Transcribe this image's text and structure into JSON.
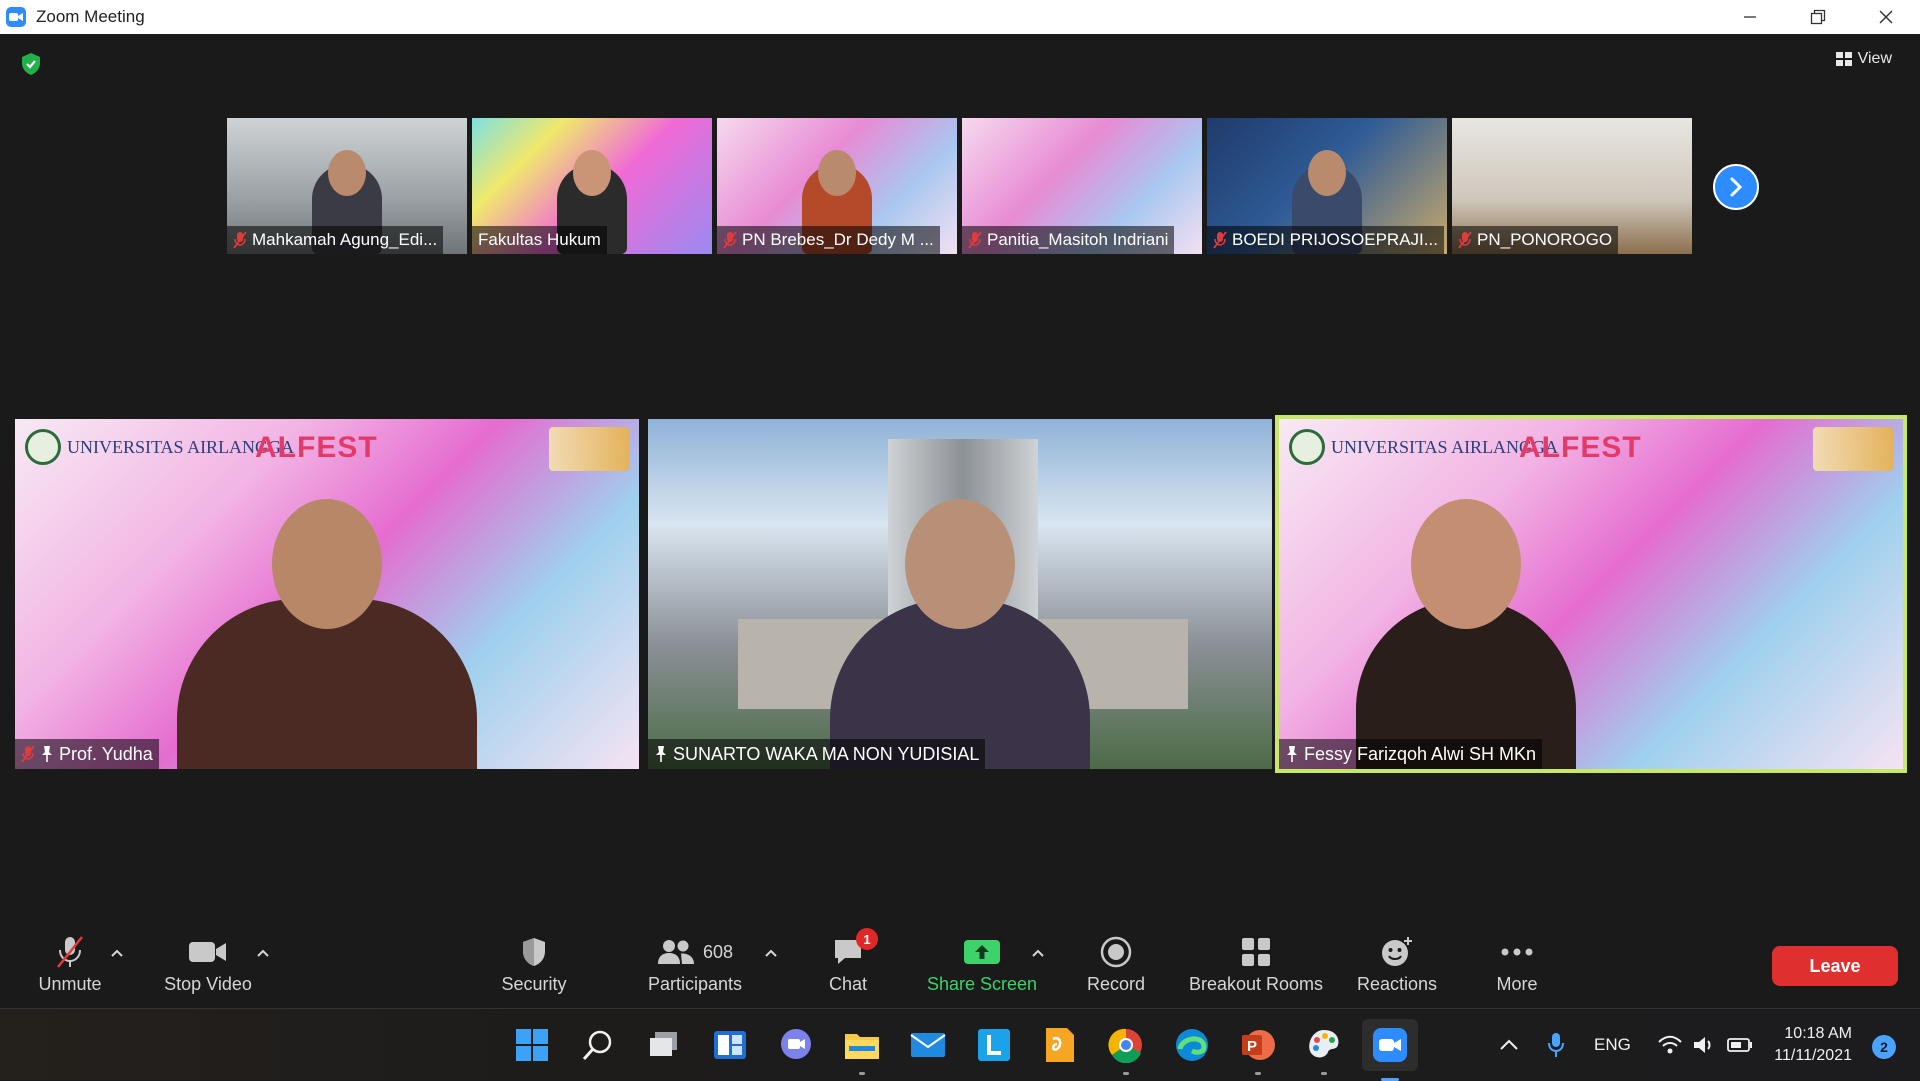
{
  "window": {
    "title": "Zoom Meeting"
  },
  "header": {
    "view_label": "View"
  },
  "strip": {
    "participants": [
      {
        "name": "Mahkamah Agung_Edi...",
        "muted": true
      },
      {
        "name": "Fakultas Hukum",
        "muted": false
      },
      {
        "name": "PN Brebes_Dr Dedy M ...",
        "muted": true
      },
      {
        "name": "Panitia_Masitoh Indriani",
        "muted": true
      },
      {
        "name": "BOEDI PRIJOSOEPRAJI...",
        "muted": true
      },
      {
        "name": "PN_PONOROGO",
        "muted": true
      }
    ]
  },
  "gallery": {
    "tiles": [
      {
        "name": "Prof. Yudha",
        "muted": true,
        "pinned": true,
        "logo_left": "UNIVERSITAS AIRLANGGA",
        "logo_mid": "ALFEST"
      },
      {
        "name": "SUNARTO WAKA MA NON YUDISIAL",
        "muted": false,
        "pinned": true
      },
      {
        "name": "Fessy Farizqoh Alwi SH MKn",
        "muted": false,
        "pinned": true,
        "speaking": true,
        "logo_left": "UNIVERSITAS AIRLANGGA",
        "logo_mid": "ALFEST"
      }
    ]
  },
  "toolbar": {
    "unmute": "Unmute",
    "stop_video": "Stop Video",
    "security": "Security",
    "participants": "Participants",
    "participants_count": "608",
    "chat": "Chat",
    "chat_badge": "1",
    "share_screen": "Share Screen",
    "record": "Record",
    "breakout_rooms": "Breakout Rooms",
    "reactions": "Reactions",
    "more": "More",
    "leave": "Leave"
  },
  "taskbar": {
    "language": "ENG",
    "time": "10:18 AM",
    "date": "11/11/2021",
    "notifications": "2"
  },
  "colors": {
    "accent_blue": "#2d8cff",
    "leave_red": "#e02f2f",
    "share_green": "#3dd26a",
    "speaker_highlight": "#c8e86a"
  }
}
